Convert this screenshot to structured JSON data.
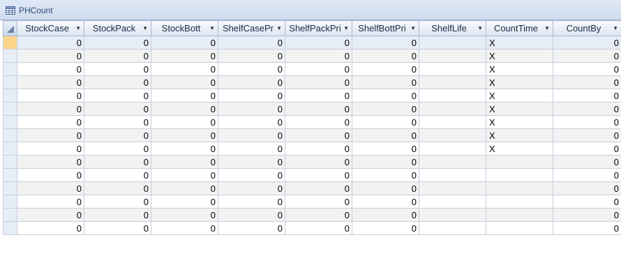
{
  "tab": {
    "title": "PHCount",
    "icon": "table-icon"
  },
  "columns": [
    {
      "key": "stockcase",
      "label": "StockCase"
    },
    {
      "key": "stockpack",
      "label": "StockPack"
    },
    {
      "key": "stockbott",
      "label": "StockBott"
    },
    {
      "key": "shelfcasepr",
      "label": "ShelfCasePr"
    },
    {
      "key": "shelfpackpri",
      "label": "ShelfPackPri"
    },
    {
      "key": "shelfbottpri",
      "label": "ShelfBottPri"
    },
    {
      "key": "shelflife",
      "label": "ShelfLife"
    },
    {
      "key": "counttime",
      "label": "CountTime"
    },
    {
      "key": "countby",
      "label": "CountBy"
    }
  ],
  "rows": [
    [
      "0",
      "0",
      "0",
      "0",
      "0",
      "0",
      "",
      "X",
      "0"
    ],
    [
      "0",
      "0",
      "0",
      "0",
      "0",
      "0",
      "",
      "X",
      "0"
    ],
    [
      "0",
      "0",
      "0",
      "0",
      "0",
      "0",
      "",
      "X",
      "0"
    ],
    [
      "0",
      "0",
      "0",
      "0",
      "0",
      "0",
      "",
      "X",
      "0"
    ],
    [
      "0",
      "0",
      "0",
      "0",
      "0",
      "0",
      "",
      "X",
      "0"
    ],
    [
      "0",
      "0",
      "0",
      "0",
      "0",
      "0",
      "",
      "X",
      "0"
    ],
    [
      "0",
      "0",
      "0",
      "0",
      "0",
      "0",
      "",
      "X",
      "0"
    ],
    [
      "0",
      "0",
      "0",
      "0",
      "0",
      "0",
      "",
      "X",
      "0"
    ],
    [
      "0",
      "0",
      "0",
      "0",
      "0",
      "0",
      "",
      "X",
      "0"
    ],
    [
      "0",
      "0",
      "0",
      "0",
      "0",
      "0",
      "",
      "",
      "0"
    ],
    [
      "0",
      "0",
      "0",
      "0",
      "0",
      "0",
      "",
      "",
      "0"
    ],
    [
      "0",
      "0",
      "0",
      "0",
      "0",
      "0",
      "",
      "",
      "0"
    ],
    [
      "0",
      "0",
      "0",
      "0",
      "0",
      "0",
      "",
      "",
      "0"
    ],
    [
      "0",
      "0",
      "0",
      "0",
      "0",
      "0",
      "",
      "",
      "0"
    ],
    [
      "0",
      "0",
      "0",
      "0",
      "0",
      "0",
      "",
      "",
      "0"
    ]
  ],
  "colors": {
    "current_row_selector": "#fcd58a",
    "header_text": "#1b2a44",
    "tab_text": "#2c4a78"
  }
}
